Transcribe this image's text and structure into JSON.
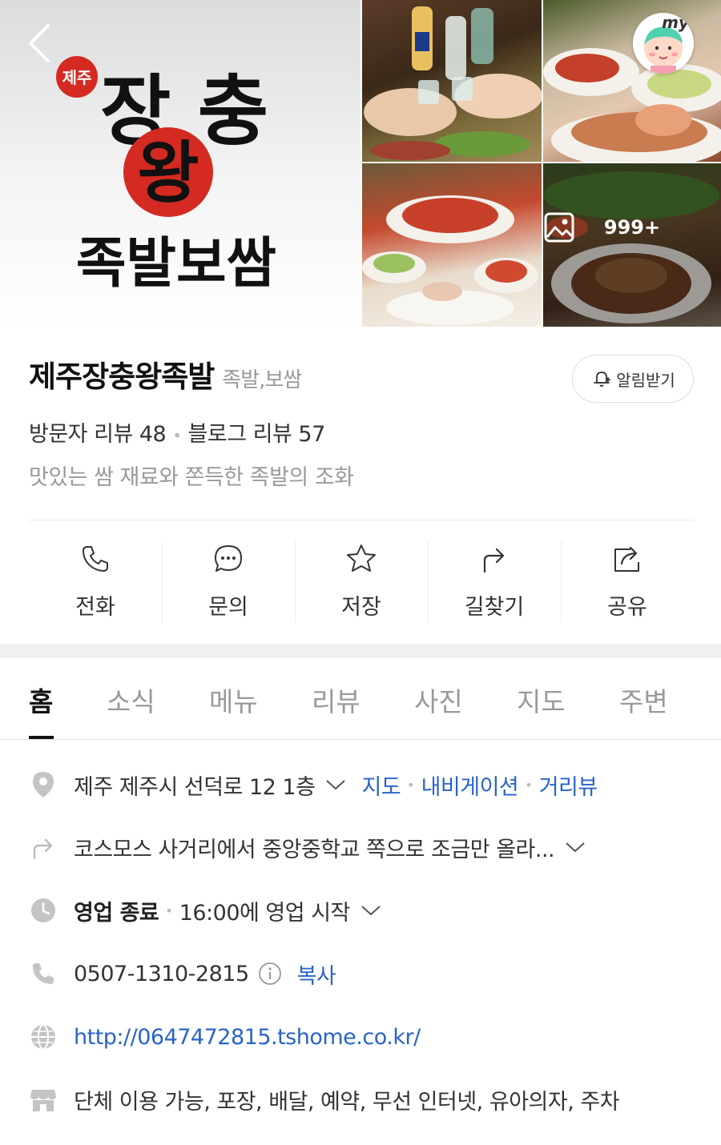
{
  "header": {
    "back_icon": "chevron-left-icon",
    "my_label": "my",
    "photo_count": "999+",
    "logo": {
      "small_text": "제주",
      "main_top": "장 충",
      "main_center": "왕",
      "main_bottom": "족발보쌈"
    }
  },
  "place": {
    "name": "제주장충왕족발",
    "category": "족발,보쌈",
    "alarm_label": "알림받기",
    "visitor_reviews": "방문자 리뷰 48",
    "blog_reviews": "블로그 리뷰 57",
    "description": "맛있는 쌈 재료와 쫀득한 족발의 조화"
  },
  "actions": [
    {
      "label": "전화",
      "icon": "phone-icon"
    },
    {
      "label": "문의",
      "icon": "chat-icon"
    },
    {
      "label": "저장",
      "icon": "star-icon"
    },
    {
      "label": "길찾기",
      "icon": "directions-icon"
    },
    {
      "label": "공유",
      "icon": "share-icon"
    }
  ],
  "tabs": [
    "홈",
    "소식",
    "메뉴",
    "리뷰",
    "사진",
    "지도",
    "주변"
  ],
  "active_tab": "홈",
  "details": {
    "address": "제주 제주시 선덕로 12 1층",
    "address_links": [
      "지도",
      "내비게이션",
      "거리뷰"
    ],
    "directions": "코스모스 사거리에서 중앙중학교 쪽으로 조금만 올라...",
    "hours_status": "영업 종료",
    "hours_next": "16:00에 영업 시작",
    "phone": "0507-1310-2815",
    "copy_label": "복사",
    "website": "http://0647472815.tshome.co.kr/",
    "amenities": "단체 이용 가능, 포장, 배달, 예약, 무선 인터넷, 유아의자, 주차"
  },
  "colors": {
    "link": "#2a63c9",
    "logo_red": "#d42a22",
    "muted": "#999999"
  }
}
